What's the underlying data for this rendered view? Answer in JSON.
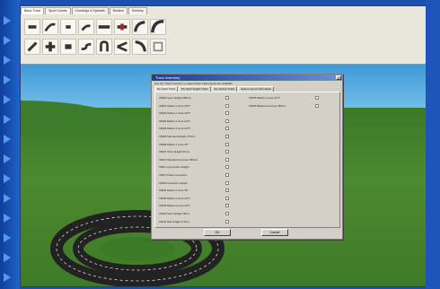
{
  "toolbar": {
    "tabs": [
      {
        "label": "Basic Track"
      },
      {
        "label": "Sport Curves"
      },
      {
        "label": "Crossings & Specials"
      },
      {
        "label": "Borders"
      },
      {
        "label": "Scenery"
      }
    ]
  },
  "dialog": {
    "title": "Track Inventory",
    "hint": "Use the Track Inventory to select which track pieces are available",
    "tabs": [
      {
        "label": "My Sport Track"
      },
      {
        "label": "My Sport Digital Track"
      },
      {
        "label": "My Classic Track"
      },
      {
        "label": "Select Layout Information"
      }
    ],
    "left_items": [
      {
        "label": "C8200 Sport straight 350mm"
      },
      {
        "label": "C8201 Radius 1 curve 22.5°"
      },
      {
        "label": "C8202 Radius 2 curve 22.5°"
      },
      {
        "label": "C8203 Radius 3 curve 22.5°"
      },
      {
        "label": "C8204 Radius 4 curve 22.5°"
      },
      {
        "label": "C8205 Standard straight 175mm"
      },
      {
        "label": "C8206 Radius 1 curve 45°"
      },
      {
        "label": "C8207 Short straight 87mm"
      },
      {
        "label": "C8210 Standard crossover 350mm"
      },
      {
        "label": "C8211 Lap counter straight"
      },
      {
        "label": "C8217 Power connection"
      },
      {
        "label": "C8222 Crossover straight"
      },
      {
        "label": "C8234 Radius 2 curve 45°"
      },
      {
        "label": "C8235 Radius 3 curve 22.5°"
      },
      {
        "label": "C8236 Radius 4 curve 22.5°"
      },
      {
        "label": "C8243 Short straight 78mm"
      },
      {
        "label": "C8244 Half straight 175mm"
      }
    ],
    "right_items": [
      {
        "label": "C8278 Radius 1 curve 22.5°"
      },
      {
        "label": "C8296 Banked crossover 350mm"
      }
    ],
    "ok_label": "OK",
    "cancel_label": "Cancel"
  }
}
